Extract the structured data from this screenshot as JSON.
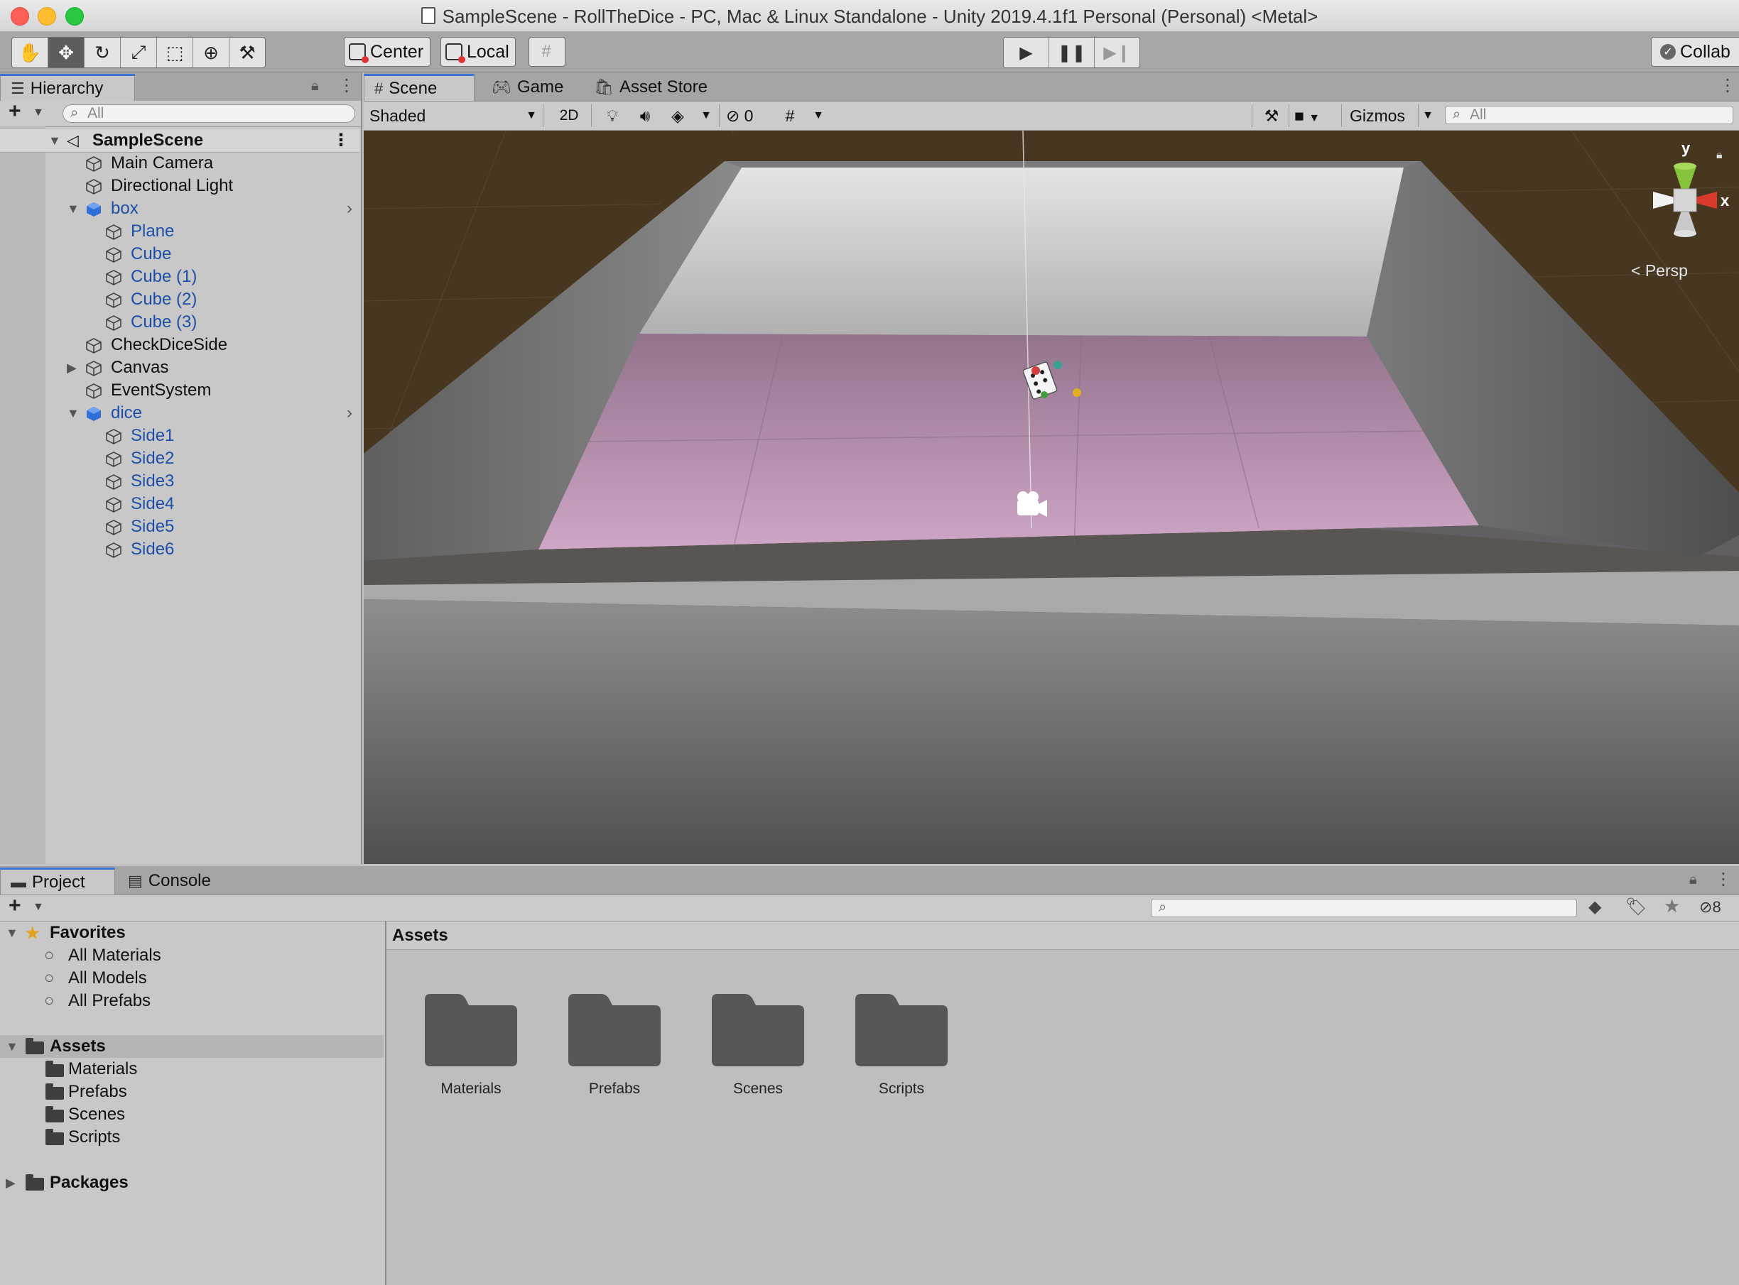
{
  "window": {
    "title": "SampleScene - RollTheDice - PC, Mac & Linux Standalone - Unity 2019.4.1f1 Personal (Personal) <Metal>"
  },
  "toolbar": {
    "tools": [
      "hand-tool",
      "move-tool",
      "rotate-tool",
      "scale-tool",
      "rect-tool",
      "transform-tool",
      "custom-tool"
    ],
    "active_tool": "move-tool",
    "pivot_label": "Center",
    "space_label": "Local",
    "collab_label": "Collab"
  },
  "hierarchy": {
    "tab_label": "Hierarchy",
    "search_placeholder": "All",
    "scene_name": "SampleScene",
    "items": [
      {
        "label": "Main Camera"
      },
      {
        "label": "Directional Light"
      },
      {
        "label": "box"
      },
      {
        "label": "Plane"
      },
      {
        "label": "Cube"
      },
      {
        "label": "Cube (1)"
      },
      {
        "label": "Cube (2)"
      },
      {
        "label": "Cube (3)"
      },
      {
        "label": "CheckDiceSide"
      },
      {
        "label": "Canvas"
      },
      {
        "label": "EventSystem"
      },
      {
        "label": "dice"
      },
      {
        "label": "Side1"
      },
      {
        "label": "Side2"
      },
      {
        "label": "Side3"
      },
      {
        "label": "Side4"
      },
      {
        "label": "Side5"
      },
      {
        "label": "Side6"
      }
    ]
  },
  "scene_view": {
    "tabs": [
      "Scene",
      "Game",
      "Asset Store"
    ],
    "shading_mode": "Shaded",
    "mode_2d": "2D",
    "hidden_count": "0",
    "gizmos_label": "Gizmos",
    "search_placeholder": "All",
    "gizmo_y": "y",
    "gizmo_x": "x",
    "projection": "Persp"
  },
  "project": {
    "tabs": [
      "Project",
      "Console"
    ],
    "hidden_count": "8",
    "favorites_label": "Favorites",
    "favorites": [
      "All Materials",
      "All Models",
      "All Prefabs"
    ],
    "assets_label": "Assets",
    "asset_folders": [
      "Materials",
      "Prefabs",
      "Scenes",
      "Scripts"
    ],
    "packages_label": "Packages",
    "breadcrumb": "Assets",
    "grid_items": [
      "Materials",
      "Prefabs",
      "Scenes",
      "Scripts"
    ]
  },
  "colors": {
    "accent": "#3c74d6",
    "prefab_blue": "#1d4fa8",
    "ground": "#473620",
    "floor_pink": "#c9a3c0",
    "wall_gray": "#7a7a7a"
  }
}
